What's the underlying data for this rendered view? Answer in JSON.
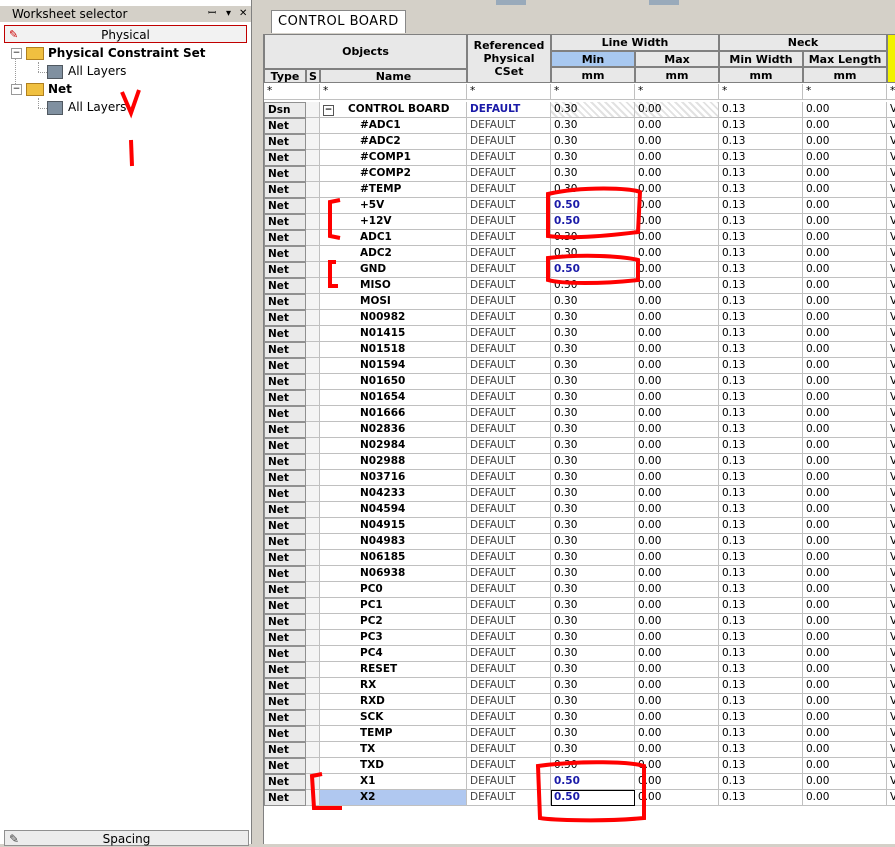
{
  "worksheet_selector": {
    "title": "Worksheet selector",
    "controls": [
      "ꟷ",
      "▾",
      "✕"
    ],
    "physical_label": "Physical",
    "tree": [
      {
        "label": "Physical Constraint Set",
        "child": "All Layers"
      },
      {
        "label": "Net",
        "child": "All Layers"
      }
    ],
    "spacing_label": "Spacing"
  },
  "tab_label": "CONTROL BOARD",
  "headers": {
    "objects": "Objects",
    "type": "Type",
    "s": "S",
    "name": "Name",
    "ref_cset": "Referenced Physical CSet",
    "line_width": "Line Width",
    "min": "Min",
    "max": "Max",
    "neck": "Neck",
    "min_width": "Min Width",
    "max_length": "Max Length",
    "unit": "mm",
    "filter": "*"
  },
  "design_row": {
    "type": "Dsn",
    "name": "CONTROL BOARD",
    "ref": "DEFAULT",
    "min": "0.30",
    "max": "0.00",
    "neck_min": "0.13",
    "neck_max": "0.00",
    "extra": "V"
  },
  "rows": [
    {
      "name": "#ADC1",
      "min": "0.30"
    },
    {
      "name": "#ADC2",
      "min": "0.30"
    },
    {
      "name": "#COMP1",
      "min": "0.30"
    },
    {
      "name": "#COMP2",
      "min": "0.30"
    },
    {
      "name": "#TEMP",
      "min": "0.30"
    },
    {
      "name": "+5V",
      "min": "0.50"
    },
    {
      "name": "+12V",
      "min": "0.50"
    },
    {
      "name": "ADC1",
      "min": "0.30"
    },
    {
      "name": "ADC2",
      "min": "0.30"
    },
    {
      "name": "GND",
      "min": "0.50"
    },
    {
      "name": "MISO",
      "min": "0.30"
    },
    {
      "name": "MOSI",
      "min": "0.30"
    },
    {
      "name": "N00982",
      "min": "0.30"
    },
    {
      "name": "N01415",
      "min": "0.30"
    },
    {
      "name": "N01518",
      "min": "0.30"
    },
    {
      "name": "N01594",
      "min": "0.30"
    },
    {
      "name": "N01650",
      "min": "0.30"
    },
    {
      "name": "N01654",
      "min": "0.30"
    },
    {
      "name": "N01666",
      "min": "0.30"
    },
    {
      "name": "N02836",
      "min": "0.30"
    },
    {
      "name": "N02984",
      "min": "0.30"
    },
    {
      "name": "N02988",
      "min": "0.30"
    },
    {
      "name": "N03716",
      "min": "0.30"
    },
    {
      "name": "N04233",
      "min": "0.30"
    },
    {
      "name": "N04594",
      "min": "0.30"
    },
    {
      "name": "N04915",
      "min": "0.30"
    },
    {
      "name": "N04983",
      "min": "0.30"
    },
    {
      "name": "N06185",
      "min": "0.30"
    },
    {
      "name": "N06938",
      "min": "0.30"
    },
    {
      "name": "PC0",
      "min": "0.30"
    },
    {
      "name": "PC1",
      "min": "0.30"
    },
    {
      "name": "PC2",
      "min": "0.30"
    },
    {
      "name": "PC3",
      "min": "0.30"
    },
    {
      "name": "PC4",
      "min": "0.30"
    },
    {
      "name": "RESET",
      "min": "0.30"
    },
    {
      "name": "RX",
      "min": "0.30"
    },
    {
      "name": "RXD",
      "min": "0.30"
    },
    {
      "name": "SCK",
      "min": "0.30"
    },
    {
      "name": "TEMP",
      "min": "0.30"
    },
    {
      "name": "TX",
      "min": "0.30"
    },
    {
      "name": "TXD",
      "min": "0.30"
    },
    {
      "name": "X1",
      "min": "0.50"
    },
    {
      "name": "X2",
      "min": "0.50",
      "selected": true
    }
  ],
  "row_defaults": {
    "type": "Net",
    "ref": "DEFAULT",
    "max": "0.00",
    "neck_min": "0.13",
    "neck_max": "0.00",
    "extra": "V"
  },
  "colors": {
    "annotation": "#ff0000",
    "selection": "#b0c8f0",
    "min_header": "#a8c8f0",
    "override_text": "#1a1aa8"
  }
}
